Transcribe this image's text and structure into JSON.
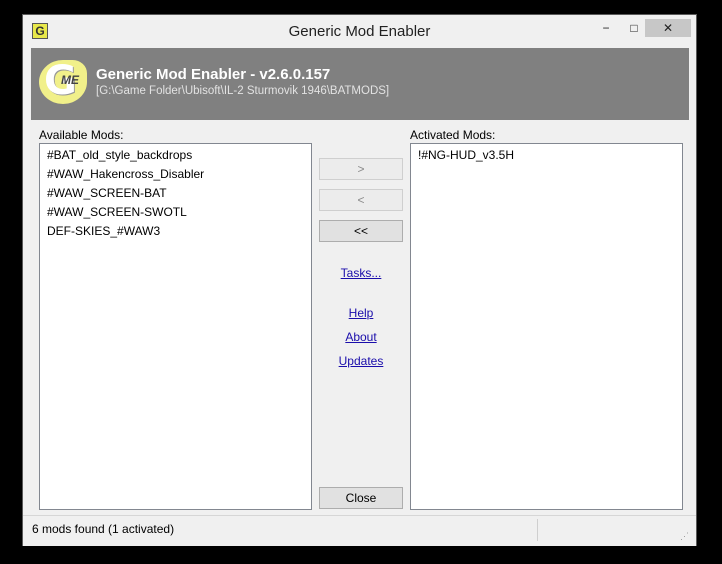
{
  "window": {
    "title": "Generic Mod Enabler",
    "controls": {
      "minimize": "−",
      "maximize": "□",
      "close": "✕"
    }
  },
  "banner": {
    "title": "Generic Mod Enabler - v2.6.0.157",
    "path": "[G:\\Game Folder\\Ubisoft\\IL-2 Sturmovik 1946\\BATMODS]"
  },
  "available": {
    "label": "Available Mods:",
    "items": [
      "#BAT_old_style_backdrops",
      "#WAW_Hakencross_Disabler",
      "#WAW_SCREEN-BAT",
      "#WAW_SCREEN-SWOTL",
      "DEF-SKIES_#WAW3"
    ]
  },
  "activated": {
    "label": "Activated Mods:",
    "items": [
      "!#NG-HUD_v3.5H"
    ]
  },
  "buttons": {
    "activate": ">",
    "deactivate": "<",
    "deactivate_all": "<<",
    "close": "Close"
  },
  "links": {
    "tasks": "Tasks...",
    "help": "Help",
    "about": "About",
    "updates": "Updates"
  },
  "status": {
    "text": "6 mods found (1 activated)"
  }
}
